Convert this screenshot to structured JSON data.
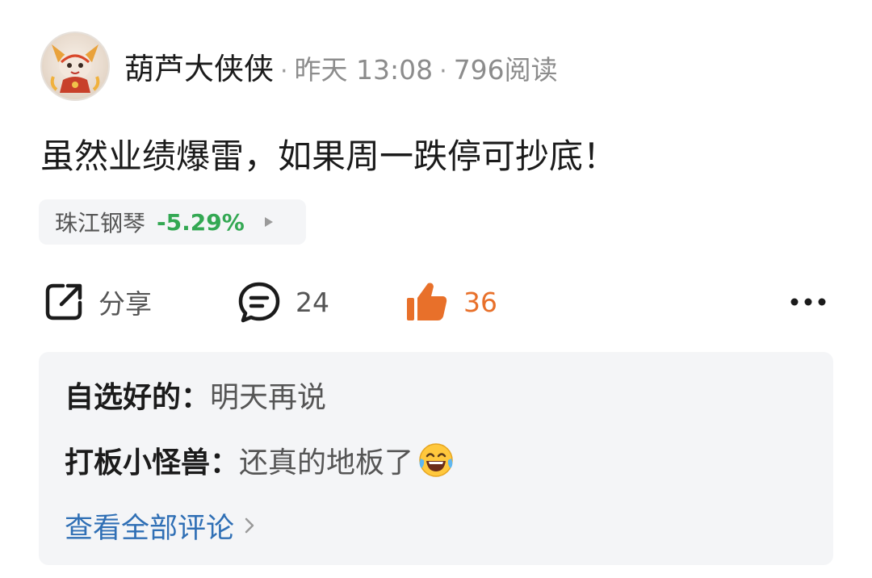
{
  "post": {
    "author": "葫芦大侠侠",
    "meta_separator": "·",
    "time": "昨天 13:08",
    "reads": "796阅读",
    "content": "虽然业绩爆雷，如果周一跌停可抄底！"
  },
  "stock": {
    "name": "珠江钢琴",
    "change": "-5.29%",
    "change_color": "#33a853"
  },
  "actions": {
    "share_label": "分享",
    "comment_count": "24",
    "like_count": "36",
    "like_color": "#e8702a"
  },
  "comments": [
    {
      "author": "自选好的：",
      "text": "明天再说"
    },
    {
      "author": "打板小怪兽：",
      "text": "还真的地板了",
      "emoji": "tears-of-joy-emoji"
    }
  ],
  "view_all_label": "查看全部评论",
  "colors": {
    "link": "#2f6fb5",
    "panel_bg": "#f4f5f7"
  }
}
